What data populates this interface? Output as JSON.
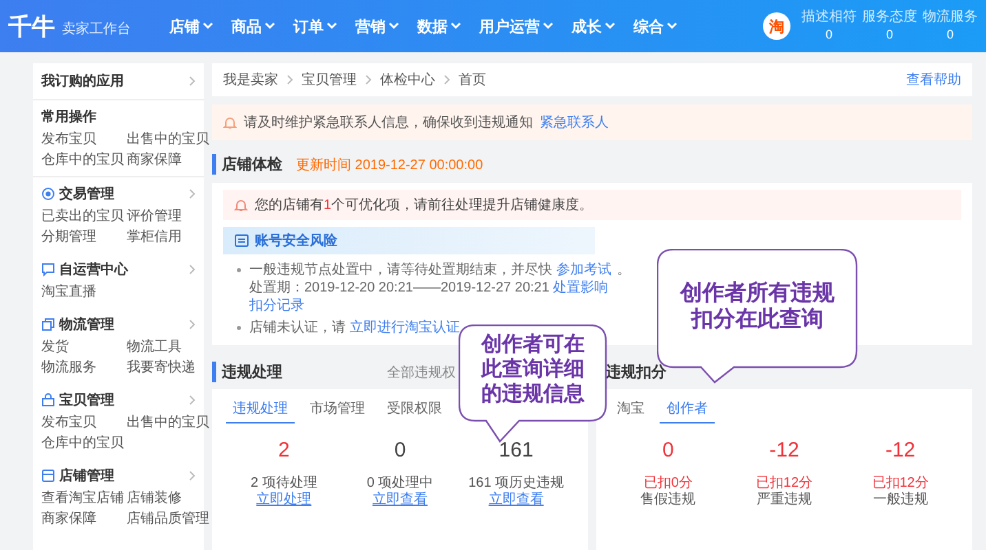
{
  "header": {
    "logo": "千牛",
    "subtitle": "卖家工作台",
    "nav": [
      {
        "label": "店铺"
      },
      {
        "label": "商品"
      },
      {
        "label": "订单"
      },
      {
        "label": "营销"
      },
      {
        "label": "数据"
      },
      {
        "label": "用户运营"
      },
      {
        "label": "成长"
      },
      {
        "label": "综合"
      }
    ],
    "badge": "淘",
    "metrics": [
      {
        "label": "描述相符",
        "value": "0"
      },
      {
        "label": "服务态度",
        "value": "0"
      },
      {
        "label": "物流服务",
        "value": "0"
      }
    ]
  },
  "sidebar": {
    "header": "我订购的应用",
    "sections": [
      {
        "kind": "plain",
        "title": "常用操作",
        "links": [
          "发布宝贝",
          "出售中的宝贝",
          "仓库中的宝贝",
          "商家保障"
        ]
      },
      {
        "kind": "group",
        "title": "交易管理",
        "links": [
          "已卖出的宝贝",
          "评价管理",
          "分期管理",
          "掌柜信用"
        ]
      },
      {
        "kind": "group",
        "title": "自运营中心",
        "links": [
          "淘宝直播"
        ]
      },
      {
        "kind": "group",
        "title": "物流管理",
        "links": [
          "发货",
          "物流工具",
          "物流服务",
          "我要寄快递"
        ]
      },
      {
        "kind": "group",
        "title": "宝贝管理",
        "links": [
          "发布宝贝",
          "出售中的宝贝",
          "仓库中的宝贝"
        ]
      },
      {
        "kind": "group",
        "title": "店铺管理",
        "links": [
          "查看淘宝店铺",
          "店铺装修",
          "商家保障",
          "店铺品质管理"
        ]
      }
    ]
  },
  "breadcrumb": [
    "我是卖家",
    "宝贝管理",
    "体检中心",
    "首页"
  ],
  "help": "查看帮助",
  "notice": {
    "text": "请及时维护紧急联系人信息，确保收到违规通知",
    "link": "紧急联系人"
  },
  "health": {
    "title": "店铺体检",
    "updated": "更新时间 2019-12-27 00:00:00",
    "alert": {
      "before": "您的店铺有",
      "count": "1",
      "after": "个可优化项，请前往处理提升店铺健康度。"
    },
    "risk": {
      "title": "账号安全风险",
      "items": [
        [
          {
            "text": "一般违规节点处置中，请等待处置期结束，并尽快",
            "link": false
          },
          {
            "text": "参加考试",
            "link": true
          },
          {
            "text": "。处置期：2019-12-20 20:21——2019-12-27 20:21",
            "link": false
          },
          {
            "text": "处置影响",
            "link": true
          },
          {
            "text": "扣分记录",
            "link": true
          }
        ],
        [
          {
            "text": "店铺未认证，请",
            "link": false
          },
          {
            "text": "立即进行淘宝认证",
            "link": true
          }
        ]
      ]
    }
  },
  "violations": {
    "title": "违规处理",
    "all_link": "全部违规权",
    "tabs": [
      {
        "label": "违规处理",
        "selected": true
      },
      {
        "label": "市场管理",
        "selected": false
      },
      {
        "label": "受限权限",
        "selected": false
      }
    ],
    "stats": [
      {
        "value": "2",
        "alert": true,
        "label": "2 项待处理",
        "action": "立即处理"
      },
      {
        "value": "0",
        "alert": false,
        "label": "0 项处理中",
        "action": "立即查看"
      },
      {
        "value": "161",
        "alert": false,
        "label": "161 项历史违规",
        "action": "立即查看"
      }
    ]
  },
  "deductions": {
    "title": "违规扣分",
    "tabs": [
      {
        "label": "淘宝",
        "selected": false
      },
      {
        "label": "创作者",
        "selected": true
      }
    ],
    "stats": [
      {
        "value": "0",
        "deducted": "已扣0分",
        "label": "售假违规"
      },
      {
        "value": "-12",
        "deducted": "已扣12分",
        "label": "严重违规"
      },
      {
        "value": "-12",
        "deducted": "已扣12分",
        "label": "一般违规"
      }
    ]
  },
  "callouts": [
    {
      "text": "创作者可在此查询详细的违规信息"
    },
    {
      "text": "创作者所有违规扣分在此查询"
    }
  ]
}
